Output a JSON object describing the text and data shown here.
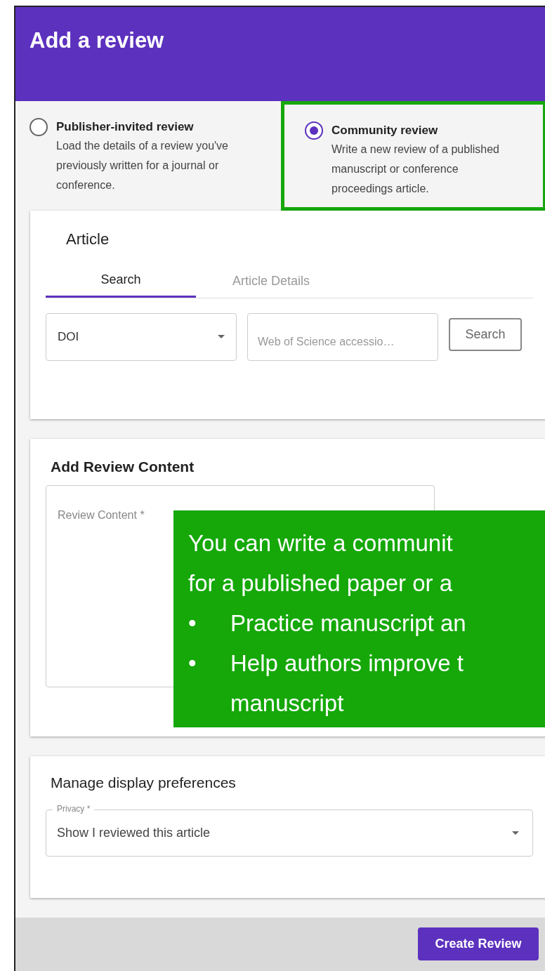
{
  "header": {
    "title": "Add a review"
  },
  "review_types": [
    {
      "title": "Publisher-invited review",
      "description": "Load the details of a review you've previously written for a journal or conference.",
      "selected": false,
      "highlighted": false
    },
    {
      "title": "Community review",
      "description": "Write a new review of a published manuscript or conference proceedings article.",
      "selected": true,
      "highlighted": true
    }
  ],
  "article": {
    "title": "Article",
    "tabs": [
      {
        "label": "Search",
        "selected": true
      },
      {
        "label": "Article Details",
        "selected": false
      }
    ],
    "id_type": "DOI",
    "search_field": {
      "placeholder": "Web of Science accessio…"
    },
    "search_button": "Search"
  },
  "review_content": {
    "title": "Add Review Content",
    "field_label": "Review Content *"
  },
  "display_preferences": {
    "title": "Manage display preferences",
    "privacy_label": "Privacy *",
    "privacy_value": "Show I reviewed this article"
  },
  "footer": {
    "button": "Create Review"
  },
  "callout": {
    "lines": [
      "You can write a communit",
      "for a published paper or a"
    ],
    "bullets": [
      {
        "bullet": "•",
        "text": "Practice manuscript an"
      },
      {
        "bullet": "•",
        "text": "Help authors improve t"
      }
    ],
    "continuation": "manuscript"
  }
}
